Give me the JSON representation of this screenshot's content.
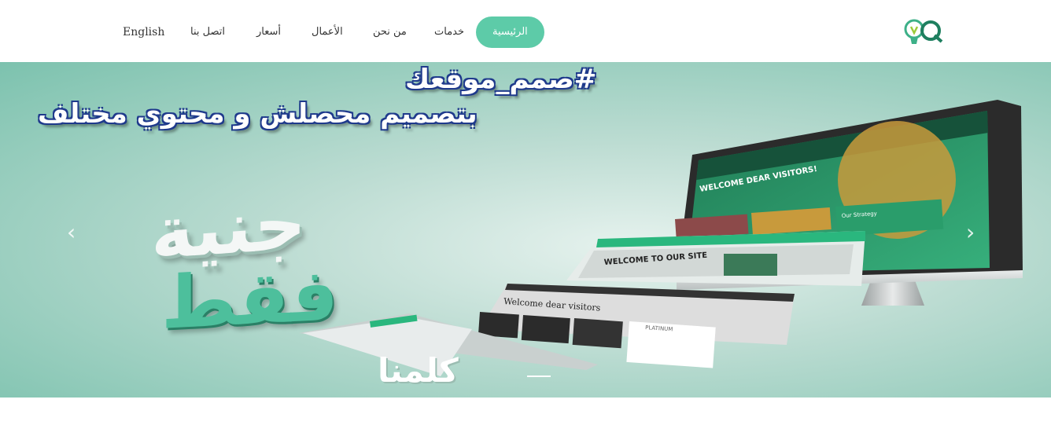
{
  "nav": {
    "items": [
      {
        "label": "English"
      },
      {
        "label": "اتصل بنا"
      },
      {
        "label": "أسعار"
      },
      {
        "label": "الأعمال"
      },
      {
        "label": "من نحن"
      },
      {
        "label": "خدمات"
      },
      {
        "label": "الرئيسية"
      }
    ]
  },
  "banner": {
    "line1": "#صمم_موقعك",
    "line2": "بتصميم محصلش و محتوي مختلف",
    "word1": "جنية",
    "word2": "فقط",
    "word3": "كلمنا",
    "screen_welcome": "WELCOME DEAR VISITORS!",
    "screen_strategy": "Our Strategy",
    "page1_title": "WELCOME TO OUR SITE",
    "page2_title": "Welcome dear visitors",
    "page2_plan": "PLATINUM",
    "prev_arrow": "‹",
    "next_arrow": "›"
  },
  "colors": {
    "accent": "#5dcba8",
    "headline_outline": "#1f3a8c"
  }
}
